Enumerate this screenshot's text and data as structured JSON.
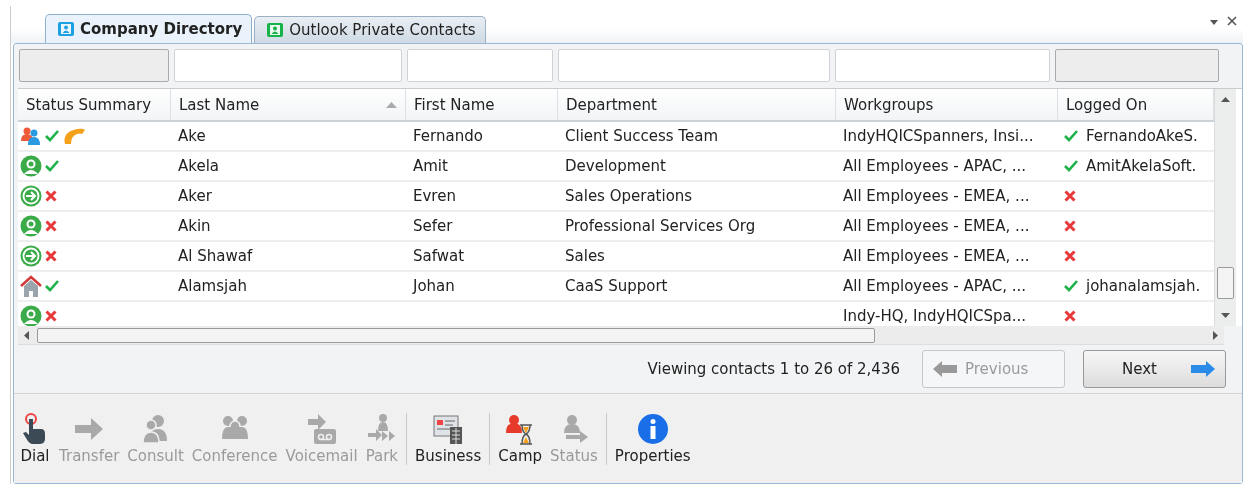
{
  "tabs": [
    {
      "label": "Company Directory",
      "selected": true,
      "color": "#1ba1e2"
    },
    {
      "label": "Outlook Private Contacts",
      "selected": false,
      "color": "#16b34a"
    }
  ],
  "filters": [
    {
      "disabled": true
    },
    {
      "disabled": false
    },
    {
      "disabled": false
    },
    {
      "disabled": false
    },
    {
      "disabled": false
    },
    {
      "disabled": true
    }
  ],
  "table": {
    "columns": [
      {
        "label": "Status Summary",
        "sorted": false
      },
      {
        "label": "Last Name",
        "sorted": true
      },
      {
        "label": "First Name",
        "sorted": false
      },
      {
        "label": "Department",
        "sorted": false
      },
      {
        "label": "Workgroups",
        "sorted": false
      },
      {
        "label": "Logged On",
        "sorted": false
      }
    ],
    "rows": [
      {
        "kind": "multi",
        "available": true,
        "on_call": true,
        "last_name": "Ake",
        "first_name": "Fernando",
        "department": "Client Success Team",
        "workgroups": "IndyHQICSpanners, Insi...",
        "logged_on": true,
        "login": "FernandoAkeS."
      },
      {
        "kind": "user",
        "available": true,
        "on_call": false,
        "last_name": "Akela",
        "first_name": "Amit",
        "department": "Development",
        "workgroups": "All Employees - APAC, ...",
        "logged_on": true,
        "login": "AmitAkelaSoft."
      },
      {
        "kind": "away",
        "available": false,
        "on_call": false,
        "last_name": "Aker",
        "first_name": "Evren",
        "department": "Sales Operations",
        "workgroups": "All Employees - EMEA, ...",
        "logged_on": false
      },
      {
        "kind": "user",
        "available": false,
        "on_call": false,
        "last_name": "Akin",
        "first_name": "Sefer",
        "department": "Professional Services Org",
        "workgroups": "All Employees - EMEA, ...",
        "logged_on": false
      },
      {
        "kind": "away",
        "available": false,
        "on_call": false,
        "last_name": "Al Shawaf",
        "first_name": "Safwat",
        "department": "Sales",
        "workgroups": "All Employees - EMEA, ...",
        "logged_on": false
      },
      {
        "kind": "home",
        "available": true,
        "on_call": false,
        "last_name": "Alamsjah",
        "first_name": "Johan",
        "department": "CaaS Support",
        "workgroups": "All Employees - APAC, ...",
        "logged_on": true,
        "login": "johanalamsjah."
      },
      {
        "kind": "user",
        "available": false,
        "on_call": false,
        "workgroups": "Indy-HQ, IndyHQICSpa...",
        "logged_on": false
      }
    ]
  },
  "pager": {
    "summary": "Viewing contacts 1 to 26 of 2,436",
    "previous": {
      "label": "Previous",
      "disabled": true
    },
    "next": {
      "label": "Next",
      "disabled": false
    }
  },
  "toolbar": [
    {
      "buttons": [
        {
          "kind": "dial",
          "label": "Dial",
          "disabled": false
        },
        {
          "kind": "transfer",
          "label": "Transfer",
          "disabled": true
        },
        {
          "kind": "consult",
          "label": "Consult",
          "disabled": true
        },
        {
          "kind": "conference",
          "label": "Conference",
          "disabled": true
        },
        {
          "kind": "voicemail",
          "label": "Voicemail",
          "disabled": true
        },
        {
          "kind": "park",
          "label": "Park",
          "disabled": true
        }
      ]
    },
    {
      "buttons": [
        {
          "kind": "business",
          "label": "Business",
          "disabled": false
        }
      ]
    },
    {
      "buttons": [
        {
          "kind": "camp",
          "label": "Camp",
          "disabled": false
        },
        {
          "kind": "status",
          "label": "Status",
          "disabled": true
        }
      ]
    },
    {
      "buttons": [
        {
          "kind": "properties",
          "label": "Properties",
          "disabled": false
        }
      ]
    }
  ]
}
